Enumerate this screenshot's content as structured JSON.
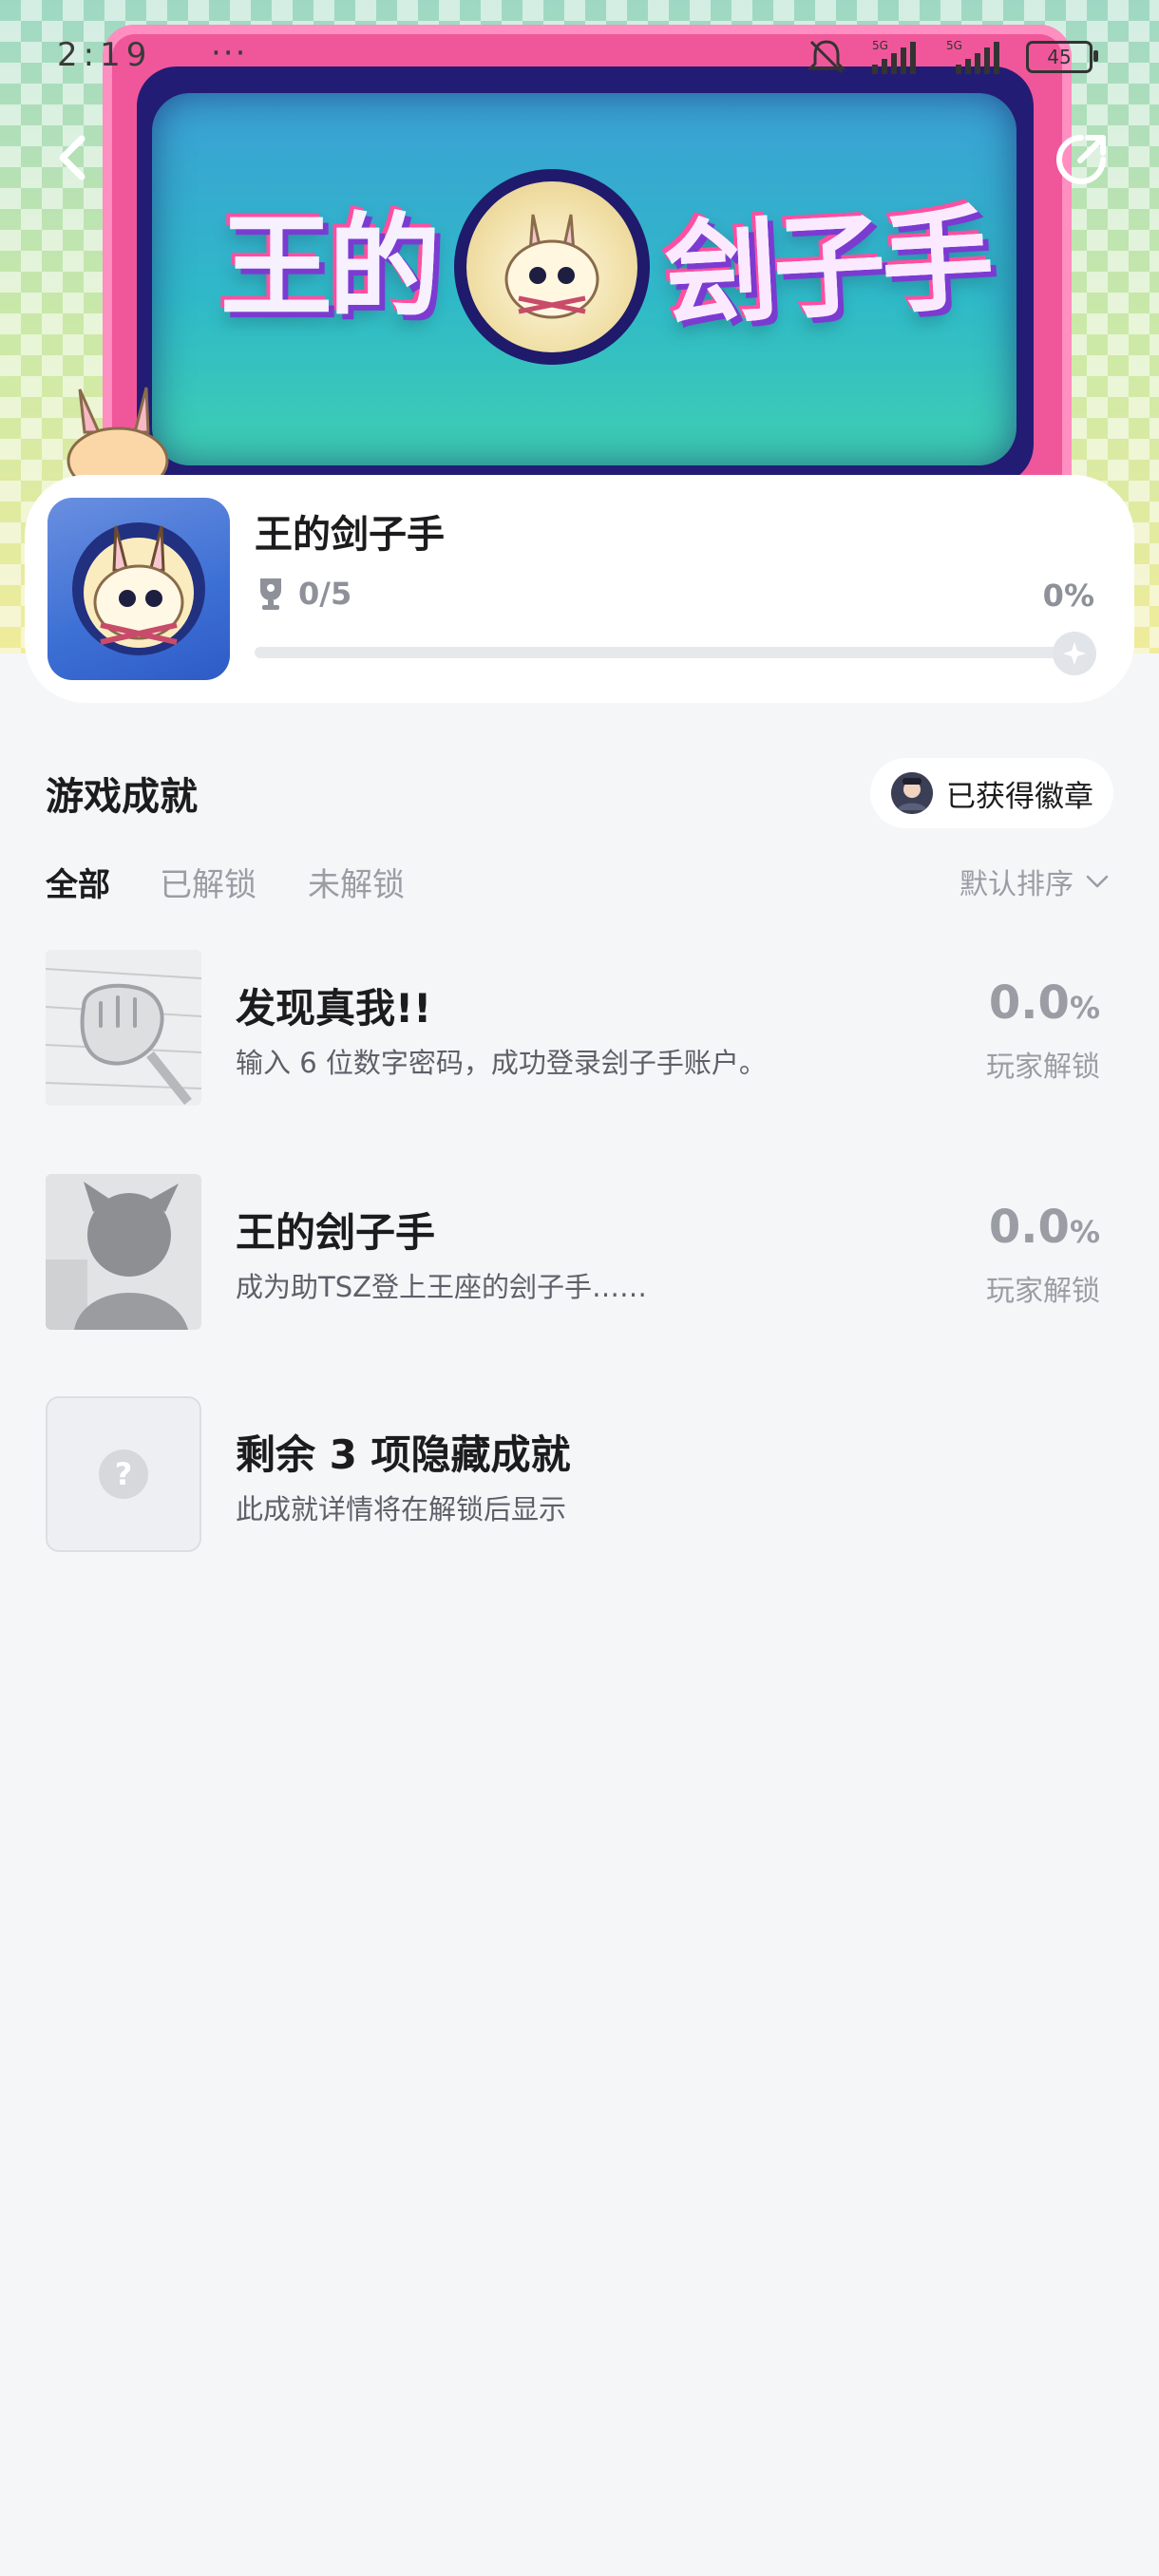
{
  "status_bar": {
    "time": "2:19",
    "dots": "···",
    "battery": "45"
  },
  "banner": {
    "logo_left": "王的",
    "logo_right": "刽子手"
  },
  "game": {
    "title": "王的剑子手",
    "trophy_count": "0/5",
    "progress_label": "0%",
    "progress_value": 0
  },
  "section": {
    "title": "游戏成就",
    "badge_button": "已获得徽章"
  },
  "tabs": [
    {
      "label": "全部",
      "active": true
    },
    {
      "label": "已解锁",
      "active": false
    },
    {
      "label": "未解锁",
      "active": false
    }
  ],
  "sort": {
    "label": "默认排序"
  },
  "achievements": [
    {
      "title": "发现真我!!",
      "desc": "输入 6 位数字密码，成功登录刽子手账户。",
      "rate": "0.0",
      "rate_unit": "%",
      "rate_label": "玩家解锁"
    },
    {
      "title": "王的刽子手",
      "desc": "成为助TSZ登上王座的刽子手……",
      "rate": "0.0",
      "rate_unit": "%",
      "rate_label": "玩家解锁"
    }
  ],
  "hidden": {
    "title": "剩余 3 项隐藏成就",
    "desc": "此成就详情将在解锁后显示",
    "icon": "?"
  }
}
